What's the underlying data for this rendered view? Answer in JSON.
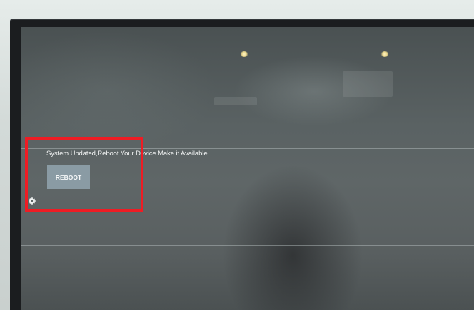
{
  "osd": {
    "message": "System Updated,Reboot Your Device Make it Available.",
    "reboot_label": "REBOOT",
    "settings_icon": "gear-icon"
  },
  "annotation": {
    "color": "#ef1c24"
  }
}
